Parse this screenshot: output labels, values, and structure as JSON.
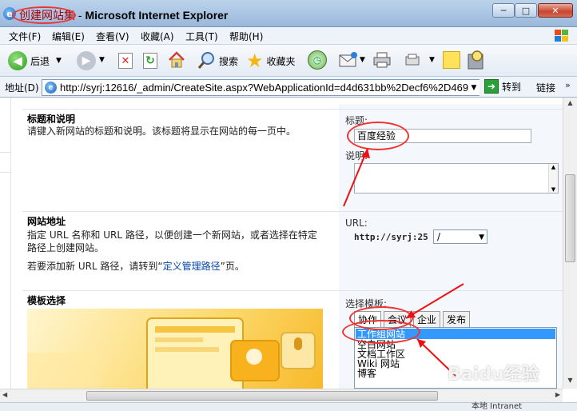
{
  "window": {
    "title_site": "创建网站集",
    "title_sep": " - ",
    "title_app": "Microsoft Internet Explorer",
    "buttons": {
      "minimize": "─",
      "maximize": "□",
      "close": "✕"
    }
  },
  "menubar": {
    "items": [
      "文件(F)",
      "编辑(E)",
      "查看(V)",
      "收藏(A)",
      "工具(T)",
      "帮助(H)"
    ]
  },
  "toolbar": {
    "back": "后退",
    "search": "搜索",
    "favorites": "收藏夹"
  },
  "addressbar": {
    "label": "地址(D)",
    "url": "http://syrj:12616/_admin/CreateSite.aspx?WebApplicationId=d4d631bb%2Decf6%2D469",
    "go": "转到",
    "links": "链接"
  },
  "page": {
    "title_section": {
      "heading": "标题和说明",
      "description": "请键入新网站的标题和说明。该标题将显示在网站的每一页中。",
      "title_label": "标题:",
      "title_value": "百度经验",
      "desc_label": "说明:"
    },
    "url_section": {
      "heading": "网站地址",
      "description_line1": "指定 URL 名称和 URL 路径，以便创建一个新网站，或者选择在特定",
      "description_line2": "路径上创建网站。",
      "link_prefix": "若要添加新 URL 路径，请转到“",
      "link_text": "定义管理路径",
      "link_suffix": "”页。",
      "url_label": "URL:",
      "url_prefix": "http://syrj:25",
      "path_value": "/"
    },
    "template_section": {
      "heading": "模板选择",
      "select_label": "选择模板:",
      "tabs": [
        "协作",
        "会议",
        "企业",
        "发布"
      ],
      "templates": [
        "工作组网站",
        "空白网站",
        "文档工作区",
        "Wiki 网站",
        "博客"
      ],
      "selected_template": "工作组网站"
    }
  },
  "status": {
    "text": "本地 Intranet"
  },
  "watermark": "Baidu经验"
}
